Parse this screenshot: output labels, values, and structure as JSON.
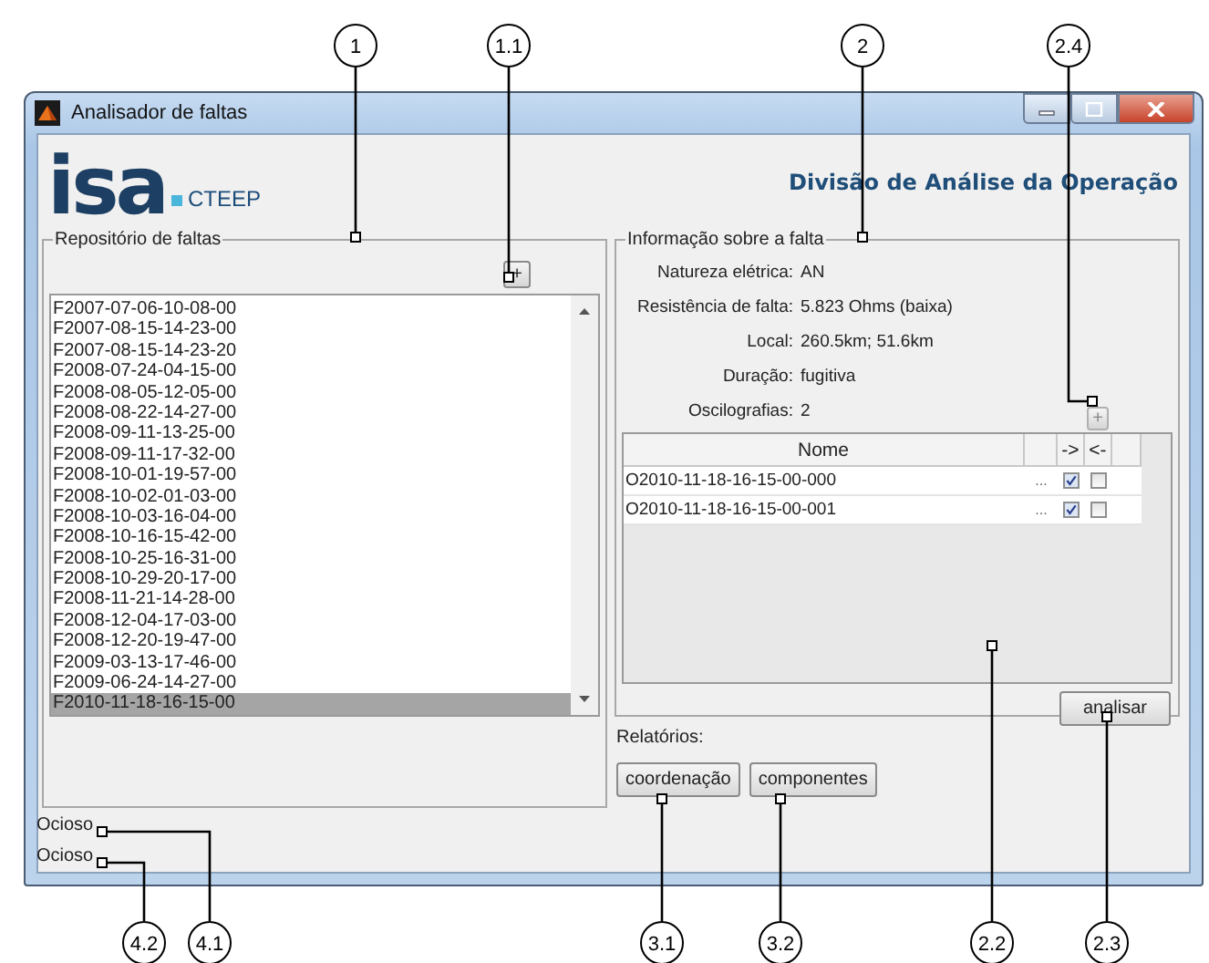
{
  "window": {
    "title": "Analisador de faltas"
  },
  "header": {
    "logo_mark": "isa",
    "logo_text": "CTEEP",
    "title": "Divisão de Análise da Operação"
  },
  "repository": {
    "legend": "Repositório de faltas",
    "add_button": "+",
    "items": [
      {
        "label": "F2007-07-06-10-08-00",
        "selected": false
      },
      {
        "label": "F2007-08-15-14-23-00",
        "selected": false
      },
      {
        "label": "F2007-08-15-14-23-20",
        "selected": false
      },
      {
        "label": "F2008-07-24-04-15-00",
        "selected": false
      },
      {
        "label": "F2008-08-05-12-05-00",
        "selected": false
      },
      {
        "label": "F2008-08-22-14-27-00",
        "selected": false
      },
      {
        "label": "F2008-09-11-13-25-00",
        "selected": false
      },
      {
        "label": "F2008-09-11-17-32-00",
        "selected": false
      },
      {
        "label": "F2008-10-01-19-57-00",
        "selected": false
      },
      {
        "label": "F2008-10-02-01-03-00",
        "selected": false
      },
      {
        "label": "F2008-10-03-16-04-00",
        "selected": false
      },
      {
        "label": "F2008-10-16-15-42-00",
        "selected": false
      },
      {
        "label": "F2008-10-25-16-31-00",
        "selected": false
      },
      {
        "label": "F2008-10-29-20-17-00",
        "selected": false
      },
      {
        "label": "F2008-11-21-14-28-00",
        "selected": false
      },
      {
        "label": "F2008-12-04-17-03-00",
        "selected": false
      },
      {
        "label": "F2008-12-20-19-47-00",
        "selected": false
      },
      {
        "label": "F2009-03-13-17-46-00",
        "selected": false
      },
      {
        "label": "F2009-06-24-14-27-00",
        "selected": false
      },
      {
        "label": "F2010-11-18-16-15-00",
        "selected": true
      }
    ]
  },
  "info": {
    "legend": "Informação sobre a falta",
    "fields": [
      {
        "label": "Natureza elétrica:",
        "value": "AN"
      },
      {
        "label": "Resistência de falta:",
        "value": "5.823 Ohms (baixa)"
      },
      {
        "label": "Local:",
        "value": "260.5km; 51.6km"
      },
      {
        "label": "Duração:",
        "value": "fugitiva"
      },
      {
        "label": "Oscilografias:",
        "value": "2"
      }
    ],
    "add_button": "+",
    "table": {
      "header": {
        "name": "Nome",
        "forward": "->",
        "backward": "<-"
      },
      "rows": [
        {
          "name": "O2010-11-18-16-15-00-000",
          "more": "...",
          "forward": true,
          "backward": false
        },
        {
          "name": "O2010-11-18-16-15-00-001",
          "more": "...",
          "forward": true,
          "backward": false
        }
      ]
    },
    "analyze_button": "analisar"
  },
  "reports": {
    "label": "Relatórios:",
    "buttons": [
      "coordenação",
      "componentes"
    ]
  },
  "status": [
    "Ocioso",
    "Ocioso"
  ],
  "callouts": [
    {
      "label": "1"
    },
    {
      "label": "1.1"
    },
    {
      "label": "2"
    },
    {
      "label": "2.4"
    },
    {
      "label": "4.2"
    },
    {
      "label": "4.1"
    },
    {
      "label": "3.1"
    },
    {
      "label": "3.2"
    },
    {
      "label": "2.2"
    },
    {
      "label": "2.3"
    }
  ]
}
